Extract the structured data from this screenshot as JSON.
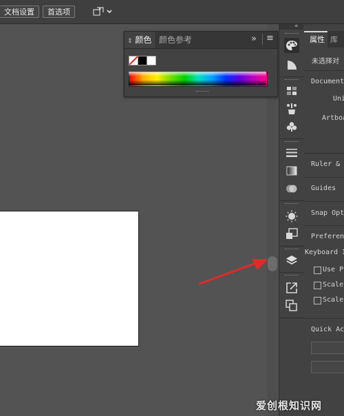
{
  "toolbar": {
    "doc_settings_label": "文档设置",
    "preferences_label": "首选项"
  },
  "color_panel": {
    "tab_color": "颜色",
    "tab_color_guide": "颜色参考",
    "expand_glyph": "»",
    "menu_glyph": "≡"
  },
  "tools": [
    "color-palette-icon",
    "color-guide-icon",
    "swatches-icon",
    "brushes-icon",
    "symbols-icon",
    "stroke-icon",
    "gradient-icon",
    "transparency-icon",
    "appearance-icon",
    "graphic-styles-icon",
    "layers-icon",
    "export-icon",
    "artboards-icon"
  ],
  "properties": {
    "tab_label": "属性",
    "tab2_label": "库",
    "no_selection": "未选择对",
    "document_label": "Document",
    "units_label": "Uni",
    "artboard_label": "Artboa",
    "rulers_label": "Ruler & G",
    "guides_label": "Guides",
    "snap_label": "Snap Opti",
    "preferences_label": "Preferen",
    "keyboard_label": "Keyboard In",
    "use_preview_label": "Use Pr",
    "scale1_label": "Scale",
    "scale2_label": "Scale",
    "quick_actions_label": "Quick Act"
  },
  "watermark": "爱创根知识网",
  "colors": {
    "annotation_arrow": "#e02a2a",
    "panel_bg": "#424242",
    "canvas_bg": "#535353"
  }
}
